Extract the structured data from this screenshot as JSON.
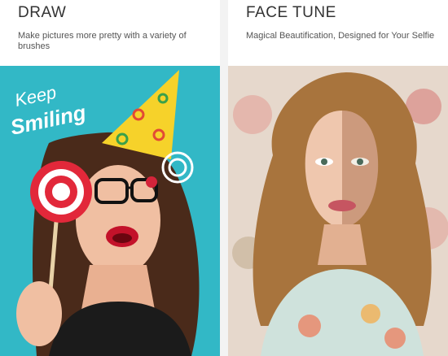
{
  "panels": [
    {
      "title": "DRAW",
      "subtitle": "Make pictures more pretty with a variety of brushes",
      "photo": {
        "doodle_text_line1": "Keep",
        "doodle_text_line2": "Smiling",
        "background_color": "#32b8c6"
      }
    },
    {
      "title": "FACE TUNE",
      "subtitle": "Magical Beautification, Designed for Your Selfie",
      "photo": {
        "background_color": "#e6d8cc"
      }
    }
  ]
}
